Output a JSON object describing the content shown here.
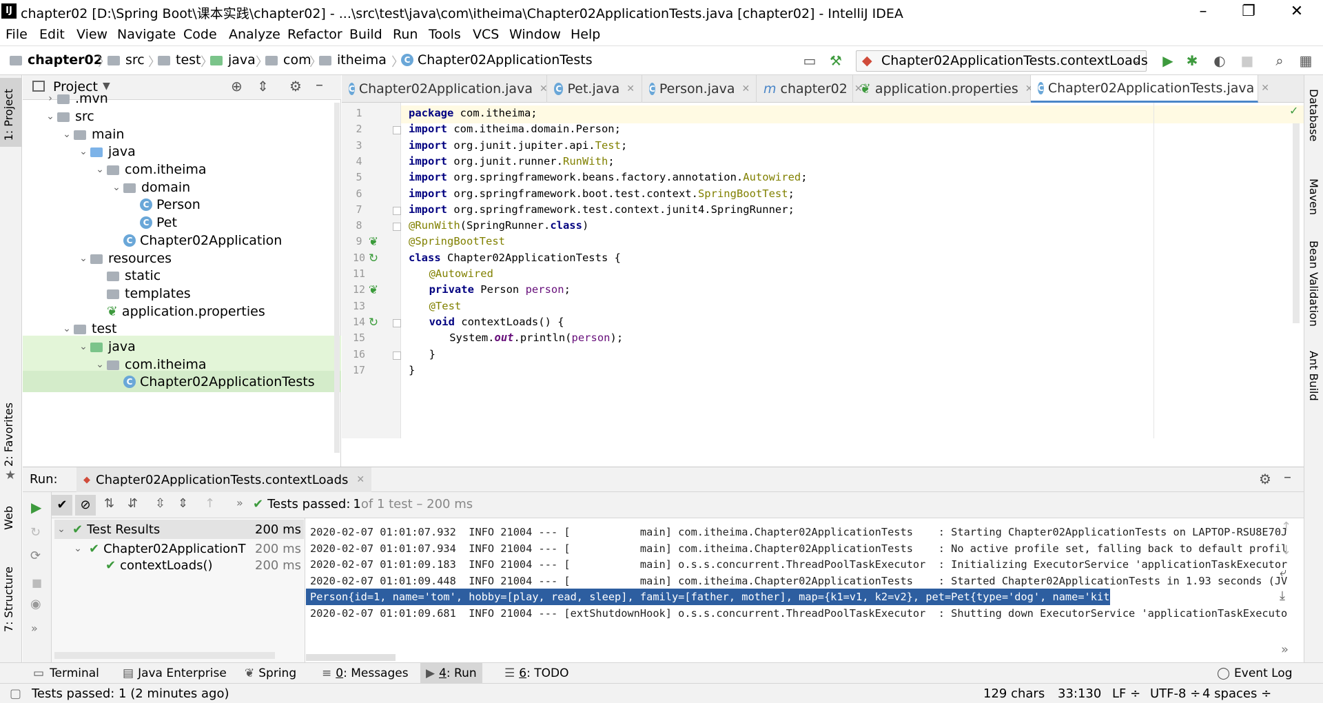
{
  "window": {
    "title": "chapter02 [D:\\Spring Boot\\课本实践\\chapter02] - ...\\src\\test\\java\\com\\itheima\\Chapter02ApplicationTests.java [chapter02] - IntelliJ IDEA",
    "logo": "IJ"
  },
  "menu": [
    "File",
    "Edit",
    "View",
    "Navigate",
    "Code",
    "Analyze",
    "Refactor",
    "Build",
    "Run",
    "Tools",
    "VCS",
    "Window",
    "Help"
  ],
  "breadcrumb": [
    "chapter02",
    "src",
    "test",
    "java",
    "com",
    "itheima",
    "Chapter02ApplicationTests"
  ],
  "run_config": "Chapter02ApplicationTests.contextLoads",
  "left_strip": {
    "project": "1: Project",
    "favorites": "2: Favorites",
    "web": "Web",
    "structure": "7: Structure"
  },
  "right_strip": {
    "database": "Database",
    "maven": "Maven",
    "bean": "Bean Validation",
    "ant": "Ant Build"
  },
  "project_panel": {
    "title": "Project",
    "tree": [
      {
        "label": ".mvn",
        "indent": 1,
        "chev": "›",
        "icon": "folder"
      },
      {
        "label": "src",
        "indent": 1,
        "chev": "⌄",
        "icon": "folder"
      },
      {
        "label": "main",
        "indent": 2,
        "chev": "⌄",
        "icon": "folder"
      },
      {
        "label": "java",
        "indent": 3,
        "chev": "⌄",
        "icon": "folder-blue"
      },
      {
        "label": "com.itheima",
        "indent": 4,
        "chev": "⌄",
        "icon": "folder"
      },
      {
        "label": "domain",
        "indent": 5,
        "chev": "⌄",
        "icon": "folder"
      },
      {
        "label": "Person",
        "indent": 6,
        "chev": "",
        "icon": "class"
      },
      {
        "label": "Pet",
        "indent": 6,
        "chev": "",
        "icon": "class"
      },
      {
        "label": "Chapter02Application",
        "indent": 5,
        "chev": "",
        "icon": "class"
      },
      {
        "label": "resources",
        "indent": 3,
        "chev": "⌄",
        "icon": "folder"
      },
      {
        "label": "static",
        "indent": 4,
        "chev": "",
        "icon": "folder"
      },
      {
        "label": "templates",
        "indent": 4,
        "chev": "",
        "icon": "folder"
      },
      {
        "label": "application.properties",
        "indent": 4,
        "chev": "",
        "icon": "leaf"
      },
      {
        "label": "test",
        "indent": 2,
        "chev": "⌄",
        "icon": "folder"
      },
      {
        "label": "java",
        "indent": 3,
        "chev": "⌄",
        "icon": "folder-green"
      },
      {
        "label": "com.itheima",
        "indent": 4,
        "chev": "⌄",
        "icon": "folder"
      },
      {
        "label": "Chapter02ApplicationTests",
        "indent": 5,
        "chev": "",
        "icon": "class"
      }
    ]
  },
  "editor_tabs": [
    {
      "label": "Chapter02Application.java",
      "active": false
    },
    {
      "label": "Pet.java",
      "active": false
    },
    {
      "label": "Person.java",
      "active": false
    },
    {
      "label": "chapter02",
      "active": false
    },
    {
      "label": "application.properties",
      "active": false
    },
    {
      "label": "Chapter02ApplicationTests.java",
      "active": true
    }
  ],
  "code_lines": [
    "1",
    "2",
    "3",
    "4",
    "5",
    "6",
    "7",
    "8",
    "9",
    "10",
    "11",
    "12",
    "13",
    "14",
    "15",
    "16",
    "17"
  ],
  "code": {
    "l1a": "package",
    "l1b": " com.itheima;",
    "l2a": "import",
    "l2b": " com.itheima.domain.Person;",
    "l3a": "import",
    "l3b": " org.junit.jupiter.api.",
    "l3c": "Test",
    ";": ";",
    "l4a": "import",
    "l4b": " org.junit.runner.",
    "l4c": "RunWith",
    "l5a": "import",
    "l5b": " org.springframework.beans.factory.annotation.",
    "l5c": "Autowired",
    "l6a": "import",
    "l6b": " org.springframework.boot.test.context.",
    "l6c": "SpringBootTest",
    "l7a": "import",
    "l7b": " org.springframework.test.context.junit4.SpringRunner;",
    "l8a": "@RunWith",
    "l8b": "(SpringRunner.",
    "l8c": "class",
    "l8d": ")",
    "l9": "@SpringBootTest",
    "l10a": "class",
    "l10b": " Chapter02ApplicationTests {",
    "l11": "@Autowired",
    "l12a": "private",
    "l12b": " Person ",
    "l12c": "person",
    "l13": "@Test",
    "l14a": "void",
    "l14b": " contextLoads() {",
    "l15a": "System.",
    "l15b": "out",
    "l15c": ".println(",
    "l15d": "person",
    "l15e": ");",
    "l16": "}",
    "l17": "}"
  },
  "run_panel": {
    "label": "Run:",
    "tab": "Chapter02ApplicationTests.contextLoads",
    "status_prefix": "Tests passed: ",
    "status_count": "1",
    "status_rest": " of 1 test – 200 ms",
    "results": [
      {
        "label": "Test Results",
        "time": "200 ms"
      },
      {
        "label": "Chapter02ApplicationT",
        "time": "200 ms"
      },
      {
        "label": "contextLoads()",
        "time": "200 ms"
      }
    ],
    "console": [
      "2020-02-07 01:01:07.932  INFO 21004 --- [           main] com.itheima.Chapter02ApplicationTests    : Starting Chapter02ApplicationTests on LAPTOP-RSU8E70J",
      "2020-02-07 01:01:07.934  INFO 21004 --- [           main] com.itheima.Chapter02ApplicationTests    : No active profile set, falling back to default profil",
      "2020-02-07 01:01:09.183  INFO 21004 --- [           main] o.s.s.concurrent.ThreadPoolTaskExecutor  : Initializing ExecutorService 'applicationTaskExecutor",
      "2020-02-07 01:01:09.448  INFO 21004 --- [           main] com.itheima.Chapter02ApplicationTests    : Started Chapter02ApplicationTests in 1.93 seconds (JV",
      "Person{id=1, name='tom', hobby=[play, read, sleep], family=[father, mother], map={k1=v1, k2=v2}, pet=Pet{type='dog', name='kity'}}",
      "2020-02-07 01:01:09.681  INFO 21004 --- [extShutdownHook] o.s.s.concurrent.ThreadPoolTaskExecutor  : Shutting down ExecutorService 'applicationTaskExecuto"
    ]
  },
  "bottom_tabs": {
    "terminal": "Terminal",
    "java_ent": "Java Enterprise",
    "spring": "Spring",
    "messages_num": "0",
    "messages": ": Messages",
    "run_num": "4",
    "run": ": Run",
    "todo_num": "6",
    "todo": ": TODO",
    "event_log": "Event Log"
  },
  "status_bar": {
    "message": "Tests passed: 1 (2 minutes ago)",
    "chars": "129 chars",
    "pos": "33:130",
    "lf": "LF ÷",
    "enc": "UTF-8 ÷",
    "indent": "4 spaces ÷"
  },
  "colors": {
    "accent": "#4a86c8",
    "selection": "#2d5ea0",
    "pass": "#3d9a3d"
  }
}
